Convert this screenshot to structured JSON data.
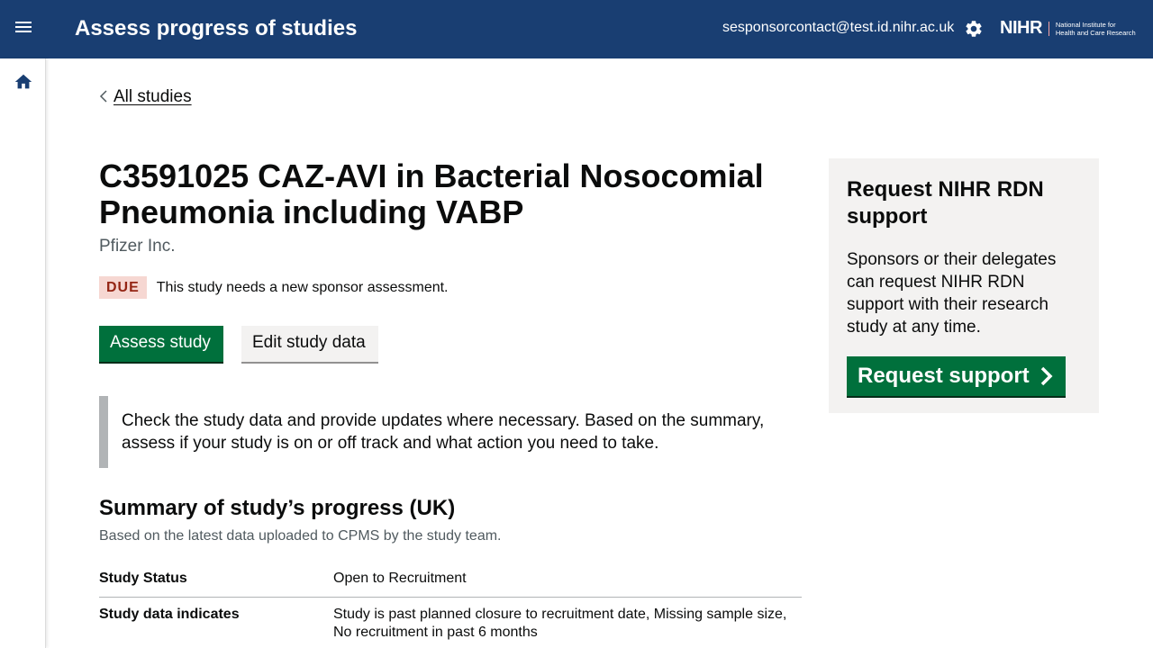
{
  "header": {
    "app_title": "Assess progress of studies",
    "user_email": "sesponsorcontact@test.id.nihr.ac.uk",
    "logo_mark": "NIHR",
    "logo_text_line1": "National Institute for",
    "logo_text_line2": "Health and Care Research",
    "menu_icon": "hamburger-menu-icon",
    "settings_icon": "gear-icon",
    "background_color": "#193e72"
  },
  "sidebar": {
    "home_icon": "home-icon"
  },
  "breadcrumb": {
    "back_label": "All studies"
  },
  "study": {
    "title": "C3591025 CAZ-AVI in Bacterial Nosocomial Pneumonia including VABP",
    "sponsor": "Pfizer Inc.",
    "status_badge": "DUE",
    "status_message": "This study needs a new sponsor assessment."
  },
  "actions": {
    "assess_label": "Assess study",
    "edit_label": "Edit study data"
  },
  "inset_text": "Check the study data and provide updates where necessary. Based on the summary, assess if your study is on or off track and what action you need to take.",
  "summary": {
    "heading": "Summary of study’s progress (UK)",
    "caption": "Based on the latest data uploaded to CPMS by the study team.",
    "rows": [
      {
        "key": "Study Status",
        "value": "Open to Recruitment"
      },
      {
        "key": "Study data indicates",
        "value": "Study is past planned closure to recruitment date, Missing sample size, No recruitment in past 6 months"
      }
    ]
  },
  "side_panel": {
    "heading": "Request NIHR RDN support",
    "body": "Sponsors or their delegates can request NIHR RDN support with their research study at any time.",
    "button_label": "Request support"
  },
  "colors": {
    "primary_green": "#00703c",
    "due_badge_bg": "#f6d7d2",
    "due_badge_text": "#942514",
    "panel_bg": "#f3f2f1"
  }
}
